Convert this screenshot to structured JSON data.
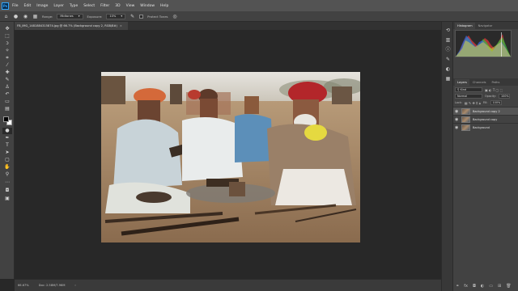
{
  "app": {
    "logo": "Ps"
  },
  "menu": [
    "File",
    "Edit",
    "Image",
    "Layer",
    "Type",
    "Select",
    "Filter",
    "3D",
    "View",
    "Window",
    "Help"
  ],
  "options": {
    "range_label": "Range:",
    "range_value": "Midtones",
    "exposure_label": "Exposure:",
    "exposure_value": "10%",
    "protect_tones": "Protect Tones"
  },
  "document_tab": {
    "title": "FB_IMG_1481884315874.jpg @ 66.7% (Background copy 2, RGB/8#)",
    "close": "×"
  },
  "status": {
    "zoom": "66.67%",
    "doc_size": "Doc: 2.58M/7.96M"
  },
  "panels": {
    "top_tabs": [
      "Histogram",
      "Navigator"
    ],
    "layer_tabs": [
      "Layers",
      "Channels",
      "Paths"
    ],
    "kind_label": "Kind",
    "blend_mode": "Normal",
    "opacity_label": "Opacity:",
    "opacity_value": "100%",
    "lock_label": "Lock:",
    "fill_label": "Fill:",
    "fill_value": "100%",
    "layers": [
      {
        "name": "Background copy 2",
        "selected": true
      },
      {
        "name": "Background copy",
        "selected": false
      },
      {
        "name": "Background",
        "selected": false
      }
    ]
  },
  "icons": {
    "tools": [
      "move-tool-icon",
      "marquee-tool-icon",
      "lasso-tool-icon",
      "quick-select-icon",
      "crop-tool-icon",
      "eyedropper-icon",
      "healing-brush-icon",
      "brush-tool-icon",
      "clone-stamp-icon",
      "history-brush-icon",
      "eraser-icon",
      "gradient-tool-icon",
      "blur-tool-icon",
      "dodge-tool-icon",
      "pen-tool-icon",
      "type-tool-icon",
      "path-select-icon",
      "rectangle-tool-icon",
      "hand-tool-icon",
      "zoom-tool-icon"
    ]
  },
  "colors": {
    "accent": "#31a8ff",
    "foreground": "#000000",
    "background": "#ffffff"
  }
}
